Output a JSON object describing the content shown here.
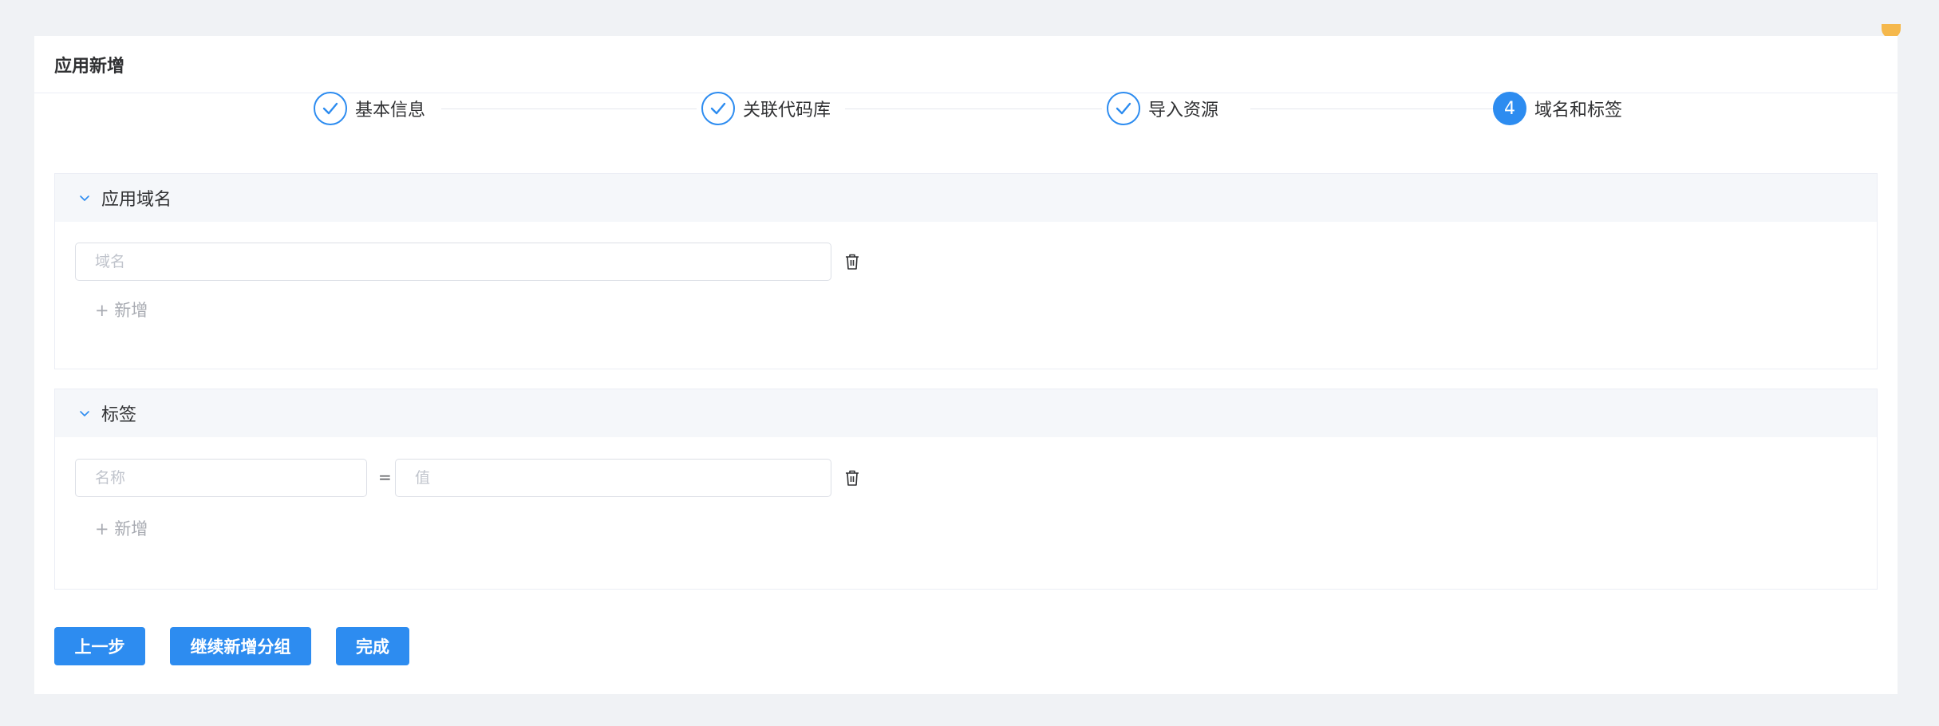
{
  "header": {
    "title": "应用新增"
  },
  "steps": [
    {
      "label": "基本信息",
      "status": "done"
    },
    {
      "label": "关联代码库",
      "status": "done"
    },
    {
      "label": "导入资源",
      "status": "done"
    },
    {
      "label": "域名和标签",
      "status": "active",
      "number": "4"
    }
  ],
  "domain_section": {
    "title": "应用域名",
    "input_placeholder": "域名",
    "add_label": "+ 新增"
  },
  "tag_section": {
    "title": "标签",
    "name_placeholder": "名称",
    "equals": "=",
    "value_placeholder": "值",
    "add_label": "+ 新增"
  },
  "buttons": {
    "prev": "上一步",
    "continue": "继续新增分组",
    "finish": "完成"
  },
  "colors": {
    "primary": "#2d8cf0",
    "background": "#f0f2f5"
  }
}
